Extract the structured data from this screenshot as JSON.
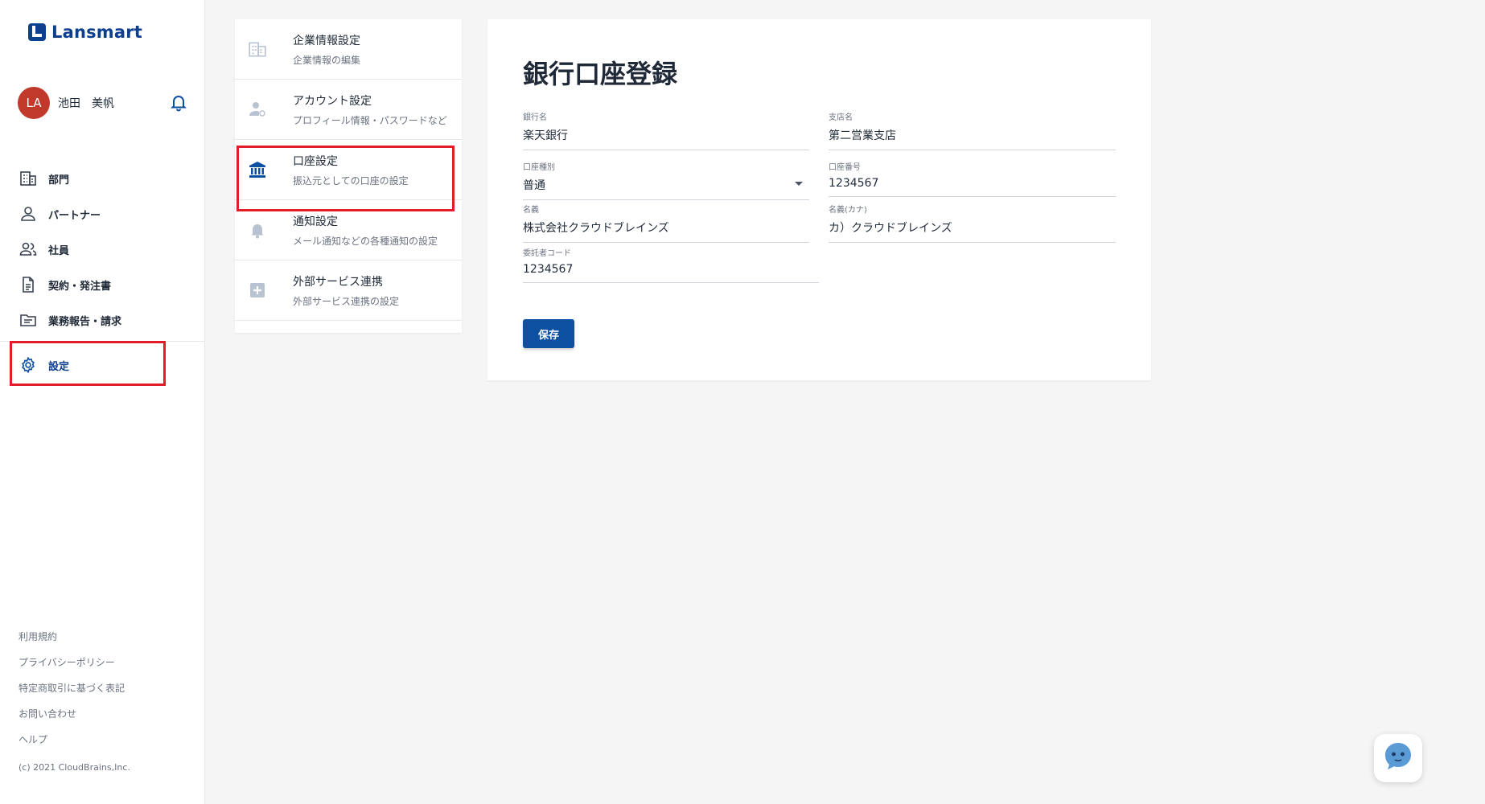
{
  "brand": {
    "name": "Lansmart",
    "color": "#0d3f8f"
  },
  "user": {
    "initials": "LA",
    "name": "池田　美帆",
    "avatar_color": "#c0392b"
  },
  "nav": {
    "items": [
      {
        "label": "部門",
        "icon": "building-icon"
      },
      {
        "label": "パートナー",
        "icon": "person-icon"
      },
      {
        "label": "社員",
        "icon": "people-icon"
      },
      {
        "label": "契約・発注書",
        "icon": "document-icon"
      },
      {
        "label": "業務報告・請求",
        "icon": "folder-icon"
      }
    ],
    "settings": {
      "label": "設定",
      "icon": "gear-icon",
      "active": true
    }
  },
  "footer": {
    "links": [
      "利用規約",
      "プライバシーポリシー",
      "特定商取引に基づく表記",
      "お問い合わせ",
      "ヘルプ"
    ],
    "copyright": "(c) 2021 CloudBrains,Inc."
  },
  "settings_menu": [
    {
      "title": "企業情報設定",
      "subtitle": "企業情報の編集",
      "icon": "building-icon"
    },
    {
      "title": "アカウント設定",
      "subtitle": "プロフィール情報・パスワードなど",
      "icon": "account-icon"
    },
    {
      "title": "口座設定",
      "subtitle": "振込元としての口座の設定",
      "icon": "bank-icon",
      "active": true
    },
    {
      "title": "通知設定",
      "subtitle": "メール通知などの各種通知の設定",
      "icon": "bell-icon"
    },
    {
      "title": "外部サービス連携",
      "subtitle": "外部サービス連携の設定",
      "icon": "plus-box-icon"
    }
  ],
  "form": {
    "title": "銀行口座登録",
    "bank_name": {
      "label": "銀行名",
      "value": "楽天銀行"
    },
    "branch_name": {
      "label": "支店名",
      "value": "第二営業支店"
    },
    "account_type": {
      "label": "口座種別",
      "value": "普通"
    },
    "account_number": {
      "label": "口座番号",
      "value": "1234567"
    },
    "holder_name": {
      "label": "名義",
      "value": "株式会社クラウドブレインズ"
    },
    "holder_kana": {
      "label": "名義(カナ)",
      "value": "カ）クラウドブレインズ"
    },
    "consignor_code": {
      "label": "委託者コード",
      "value": "1234567"
    },
    "save_label": "保存"
  },
  "colors": {
    "accent": "#0d4fa0",
    "highlight": "#e11d2a"
  }
}
